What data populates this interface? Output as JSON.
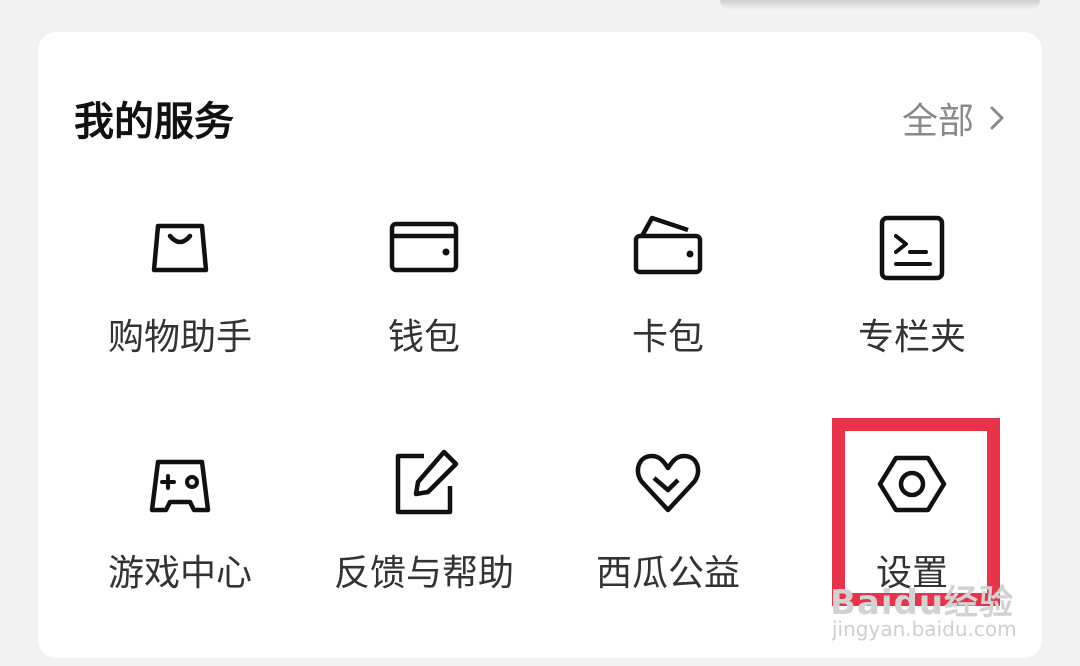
{
  "services": {
    "title": "我的服务",
    "all_label": "全部",
    "items": [
      {
        "label": "购物助手",
        "icon": "shopping-bag-icon"
      },
      {
        "label": "钱包",
        "icon": "wallet-icon"
      },
      {
        "label": "卡包",
        "icon": "card-wallet-icon"
      },
      {
        "label": "专栏夹",
        "icon": "column-folder-icon"
      },
      {
        "label": "游戏中心",
        "icon": "gamepad-icon"
      },
      {
        "label": "反馈与帮助",
        "icon": "edit-feedback-icon"
      },
      {
        "label": "西瓜公益",
        "icon": "heart-icon"
      },
      {
        "label": "设置",
        "icon": "settings-icon"
      }
    ]
  },
  "watermark": {
    "logo": "Baidu经验",
    "site": "jingyan.baidu.com"
  },
  "colors": {
    "highlight": "#e8344a",
    "text": "#333333",
    "muted": "#8a8a8a"
  }
}
